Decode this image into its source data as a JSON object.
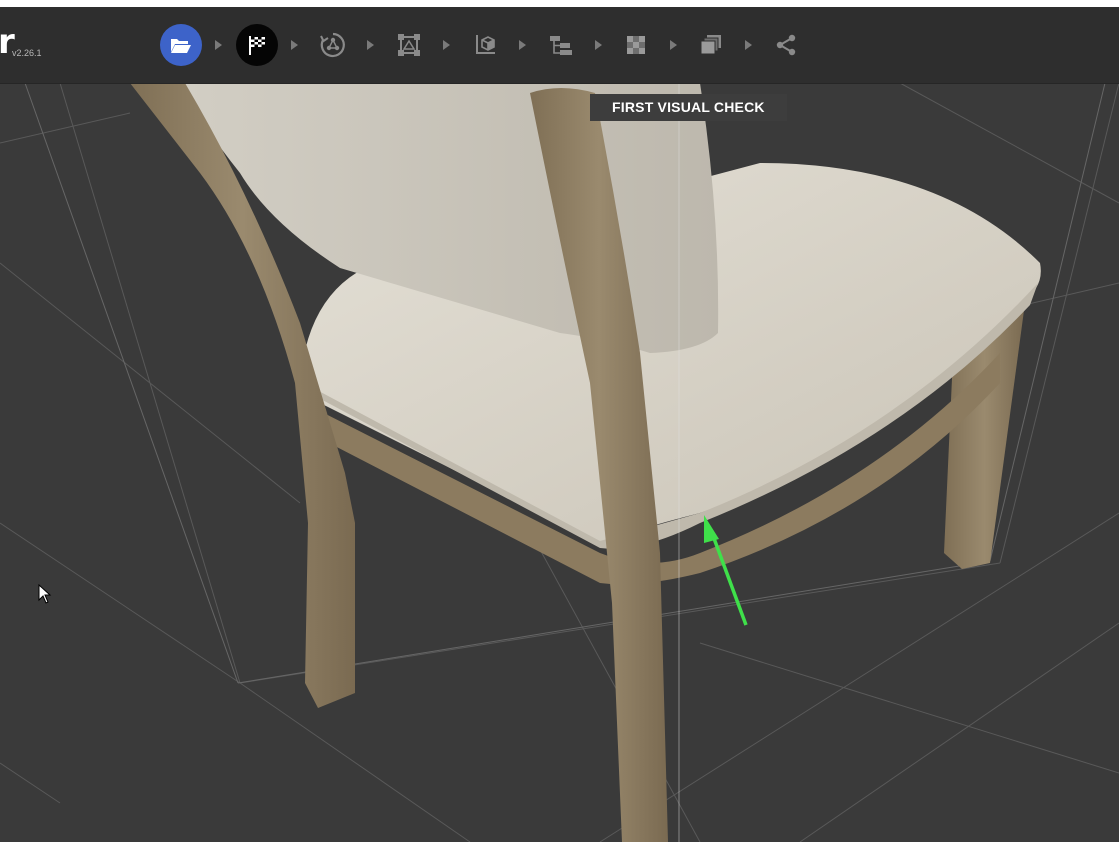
{
  "app": {
    "logo_letter": "r",
    "version": "v2.26.1"
  },
  "workflow": {
    "steps": [
      {
        "name": "open-file",
        "icon": "folder-open-icon",
        "state": "complete"
      },
      {
        "name": "first-visual-check",
        "icon": "checkered-flag-icon",
        "state": "current"
      },
      {
        "name": "step-3",
        "icon": "circular-arrows-icon",
        "state": "pending"
      },
      {
        "name": "step-4",
        "icon": "vertex-square-icon",
        "state": "pending"
      },
      {
        "name": "step-5",
        "icon": "uv-unwrap-icon",
        "state": "pending"
      },
      {
        "name": "step-6",
        "icon": "hierarchy-icon",
        "state": "pending"
      },
      {
        "name": "step-7",
        "icon": "checker-texture-icon",
        "state": "pending"
      },
      {
        "name": "step-8",
        "icon": "stacked-layers-icon",
        "state": "pending"
      },
      {
        "name": "step-9",
        "icon": "share-icon",
        "state": "pending"
      }
    ]
  },
  "stage": {
    "label": "FIRST VISUAL CHECK"
  },
  "viewport": {
    "subject": "chair-model",
    "colors": {
      "background": "#3a3a3a",
      "grid": "#595959",
      "wood": "#8d7c60",
      "fabric": "#d8d3c8",
      "annotation_arrow": "#3fe04a",
      "accent_blue": "#3d63c9"
    }
  }
}
